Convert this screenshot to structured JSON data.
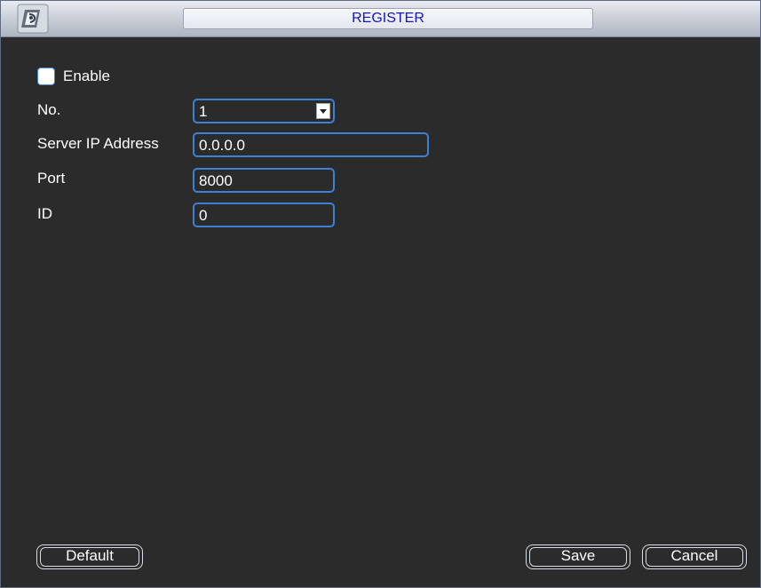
{
  "window": {
    "title": "REGISTER",
    "accent_color": "#1414c8",
    "field_border_color": "#3f7fd6",
    "background_color": "#2b2b2b"
  },
  "form": {
    "enable": {
      "label": "Enable",
      "checked": false
    },
    "no": {
      "label": "No.",
      "value": "1",
      "icon": "chevron-down-icon"
    },
    "server_ip": {
      "label": "Server IP Address",
      "value": "0.0.0.0"
    },
    "port": {
      "label": "Port",
      "value": "8000"
    },
    "id": {
      "label": "ID",
      "value": "0"
    }
  },
  "buttons": {
    "default_label": "Default",
    "save_label": "Save",
    "cancel_label": "Cancel"
  }
}
